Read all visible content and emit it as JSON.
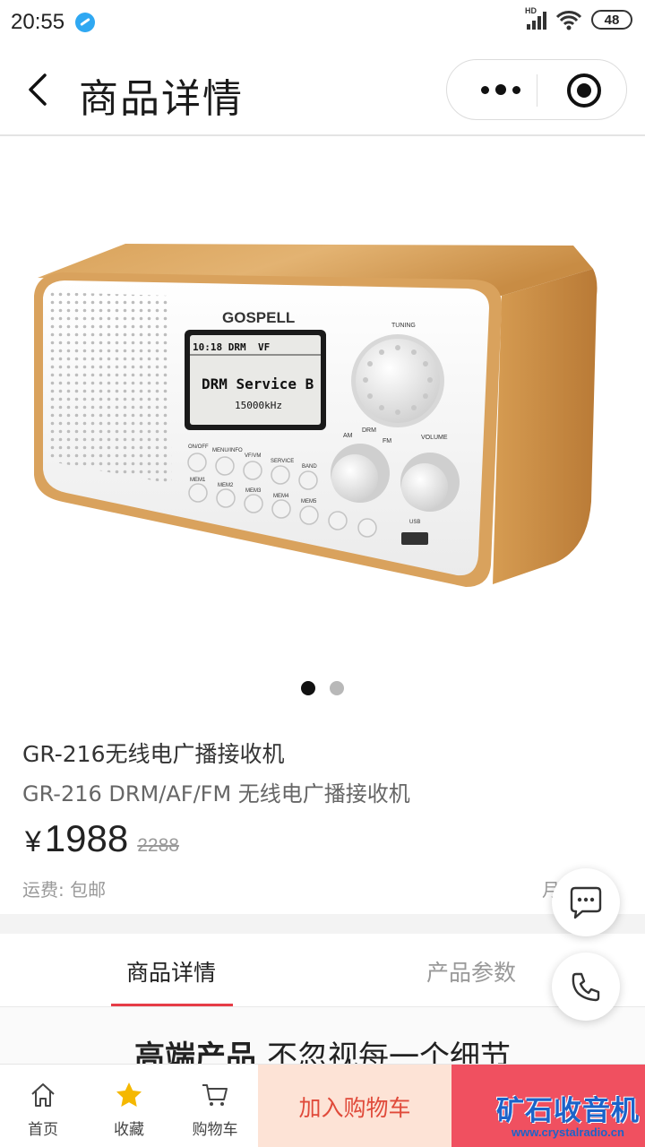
{
  "status_bar": {
    "time": "20:55",
    "network_label": "HD",
    "battery": "48"
  },
  "nav": {
    "title": "商品详情"
  },
  "product": {
    "brand_on_device": "GOSPELL",
    "display_line1": "10:18 DRM",
    "display_vf": "VF",
    "display_main": "DRM Service B",
    "display_freq": "15000kHz",
    "knob_labels": {
      "tuning": "TUNING",
      "am": "AM",
      "drm": "DRM",
      "fm": "FM",
      "volume": "VOLUME",
      "usb": "USB"
    },
    "button_labels_row1": [
      "ON/OFF",
      "MENU/INFO",
      "VF/VM",
      "SERVICE",
      "BAND"
    ],
    "button_labels_row2": [
      "MEM1",
      "MEM2",
      "MEM3",
      "MEM4",
      "MEM5"
    ],
    "name": "GR-216无线电广播接收机",
    "subtitle": "GR-216 DRM/AF/FM 无线电广播接收机",
    "price_symbol": "¥",
    "price": "1988",
    "original_price": "2288",
    "shipping": "运费: 包邮",
    "sales_partial": "月      荐"
  },
  "carousel": {
    "total": 2,
    "active_index": 0
  },
  "tabs": [
    {
      "label": "商品详情",
      "active": true
    },
    {
      "label": "产品参数",
      "active": false
    }
  ],
  "content": {
    "heading_bold": "高端产品",
    "heading_rest": "不忽视每一个细节"
  },
  "bottom_bar": {
    "home_label": "首页",
    "favorite_label": "收藏",
    "cart_label": "购物车",
    "add_to_cart_label": "加入购物车"
  },
  "watermark": {
    "title": "矿石收音机",
    "url": "www.crystalradio.cn"
  },
  "colors": {
    "accent_red": "#e63c46",
    "buy_button": "#f05060",
    "add_cart_bg": "#fde3d6",
    "favorite_star": "#f5b800"
  },
  "icons": [
    "back-icon",
    "more-icon",
    "close-target-icon",
    "chat-icon",
    "phone-icon",
    "home-icon",
    "star-icon",
    "cart-icon"
  ]
}
